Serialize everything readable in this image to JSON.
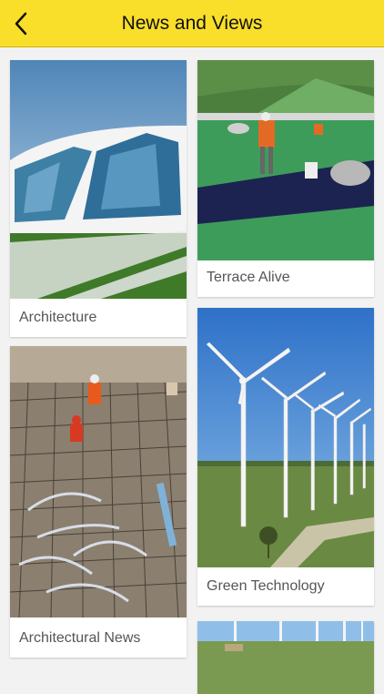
{
  "header": {
    "title": "News and Views",
    "back_icon": "chevron-left-icon"
  },
  "cards": [
    {
      "label": "Architecture"
    },
    {
      "label": "Terrace Alive"
    },
    {
      "label": "Architectural News"
    },
    {
      "label": "Green Technology"
    },
    {
      "label": ""
    }
  ],
  "colors": {
    "header": "#f9de2a",
    "background": "#f2f2f2",
    "label_text": "#555555"
  }
}
